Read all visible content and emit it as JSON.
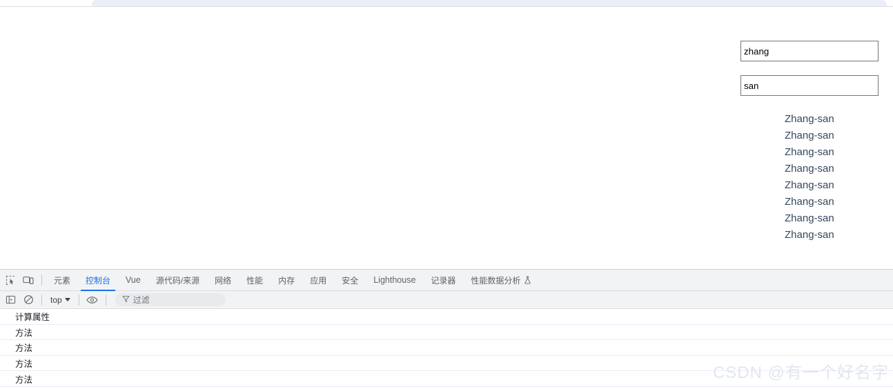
{
  "page": {
    "inputs": [
      {
        "name": "first-name",
        "value": "zhang",
        "placeholder": ""
      },
      {
        "name": "last-name",
        "value": "san",
        "placeholder": ""
      }
    ],
    "name_list": [
      "Zhang-san",
      "Zhang-san",
      "Zhang-san",
      "Zhang-san",
      "Zhang-san",
      "Zhang-san",
      "Zhang-san",
      "Zhang-san"
    ]
  },
  "devtools": {
    "tabs": [
      {
        "label": "元素",
        "active": false,
        "latin": false
      },
      {
        "label": "控制台",
        "active": true,
        "latin": false
      },
      {
        "label": "Vue",
        "active": false,
        "latin": true
      },
      {
        "label": "源代码/来源",
        "active": false,
        "latin": false
      },
      {
        "label": "网络",
        "active": false,
        "latin": false
      },
      {
        "label": "性能",
        "active": false,
        "latin": false
      },
      {
        "label": "内存",
        "active": false,
        "latin": false
      },
      {
        "label": "应用",
        "active": false,
        "latin": false
      },
      {
        "label": "安全",
        "active": false,
        "latin": false
      },
      {
        "label": "Lighthouse",
        "active": false,
        "latin": true
      },
      {
        "label": "记录器",
        "active": false,
        "latin": false
      },
      {
        "label": "性能数据分析",
        "active": false,
        "latin": false,
        "flask": true
      }
    ],
    "toolbar": {
      "context_label": "top",
      "filter_placeholder": "过滤"
    },
    "console_messages": [
      "计算属性",
      "方法",
      "方法",
      "方法",
      "方法"
    ]
  },
  "watermark": {
    "text": "CSDN @有一个好名字"
  },
  "colors": {
    "accent": "#1a73e8",
    "tabbar_bg": "#f1f3f4",
    "name_text": "#33475f",
    "watermark": "#e2e6ef"
  }
}
